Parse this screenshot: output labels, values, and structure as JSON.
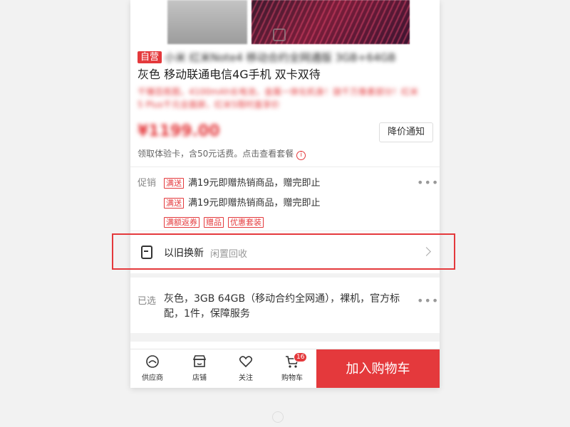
{
  "product": {
    "tag": "自营",
    "title_line1_blurred": "小米 红米Note4 移动合约全网通版 3GB+64GB",
    "title_line2": "灰色 移动联通电信4G手机 双卡双待",
    "promo_blurred": "千锤百炼图，4100mAh长电池，金属一体化机身！骁千万像素部分！红米5 Plus千元全面屏，红米5限时直享价",
    "price_blurred": "¥1199.00",
    "notify_button": "降价通知",
    "tip_text": "领取体验卡，含50元话费。点击查看套餐",
    "tip_icon": "info-icon"
  },
  "promotion": {
    "label": "促销",
    "rows": [
      {
        "tag": "满送",
        "text": "满19元即赠热销商品，赠完即止"
      },
      {
        "tag": "满送",
        "text": "满19元即赠热销商品，赠完即止"
      }
    ],
    "tags": [
      "满额返券",
      "赠品",
      "优惠套装"
    ],
    "more": "•••"
  },
  "tradein": {
    "icon": "refresh-phone-icon",
    "title": "以旧换新",
    "subtitle": "闲置回收"
  },
  "selected": {
    "label": "已选",
    "value": "灰色，3GB 64GB（移动合约全网通），裸机，官方标配，1件，保障服务",
    "more": "•••"
  },
  "bottombar": {
    "items": [
      {
        "label": "供应商",
        "icon": "supplier-icon"
      },
      {
        "label": "店铺",
        "icon": "store-icon"
      },
      {
        "label": "关注",
        "icon": "heart-icon"
      },
      {
        "label": "购物车",
        "icon": "cart-icon",
        "badge": "16"
      }
    ],
    "cta": "加入购物车"
  },
  "colors": {
    "accent": "#e4393c",
    "highlight_box": "#e4393c"
  }
}
